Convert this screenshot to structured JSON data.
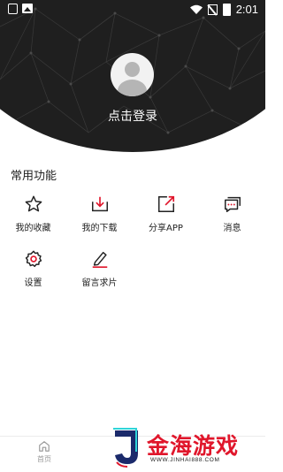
{
  "status_bar": {
    "time": "2:01"
  },
  "profile": {
    "login_label": "点击登录"
  },
  "section": {
    "title": "常用功能"
  },
  "features": [
    {
      "label": "我的收藏",
      "icon": "star-icon"
    },
    {
      "label": "我的下载",
      "icon": "download-icon"
    },
    {
      "label": "分享APP",
      "icon": "share-icon"
    },
    {
      "label": "消息",
      "icon": "message-icon"
    },
    {
      "label": "设置",
      "icon": "gear-icon"
    },
    {
      "label": "留言求片",
      "icon": "edit-icon"
    }
  ],
  "bottom_nav": {
    "home_label": "首页"
  },
  "watermark": {
    "text": "金海游戏",
    "url": "WWW.JINHAI888.COM"
  },
  "colors": {
    "header_bg": "#1f1f1f",
    "accent": "#e0162b"
  }
}
